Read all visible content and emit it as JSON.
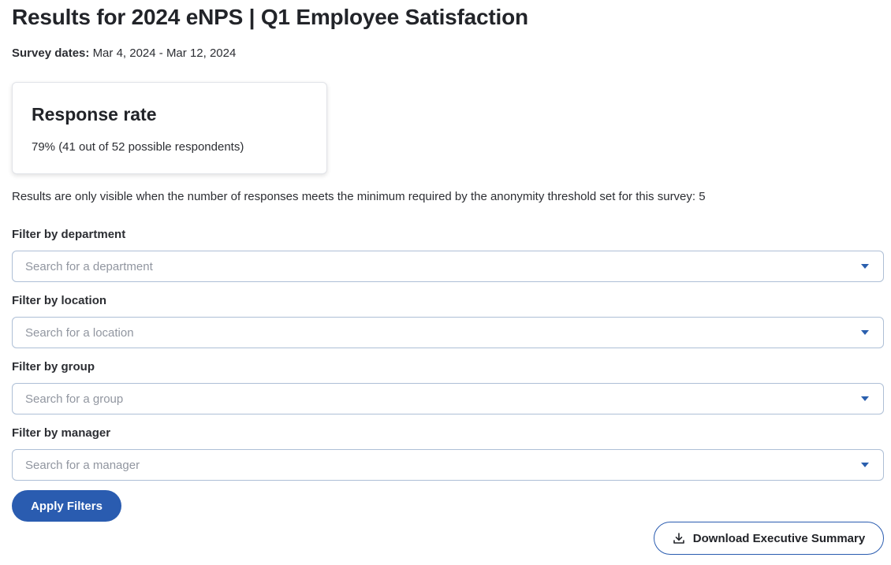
{
  "header": {
    "title": "Results for 2024 eNPS | Q1 Employee Satisfaction",
    "survey_dates_label": "Survey dates:",
    "survey_dates_value": "Mar 4, 2024 - Mar 12, 2024"
  },
  "response_card": {
    "title": "Response rate",
    "value": "79% (41 out of 52 possible respondents)"
  },
  "notice": "Results are only visible when the number of responses meets the minimum required by the anonymity threshold set for this survey: 5",
  "filters": {
    "department": {
      "label": "Filter by department",
      "placeholder": "Search for a department"
    },
    "location": {
      "label": "Filter by location",
      "placeholder": "Search for a location"
    },
    "group": {
      "label": "Filter by group",
      "placeholder": "Search for a group"
    },
    "manager": {
      "label": "Filter by manager",
      "placeholder": "Search for a manager"
    }
  },
  "actions": {
    "apply_label": "Apply Filters",
    "download_label": "Download Executive Summary",
    "download_icon": "download-icon"
  },
  "colors": {
    "primary": "#2a5cb0",
    "border": "#aebfd6",
    "text": "#222429"
  }
}
